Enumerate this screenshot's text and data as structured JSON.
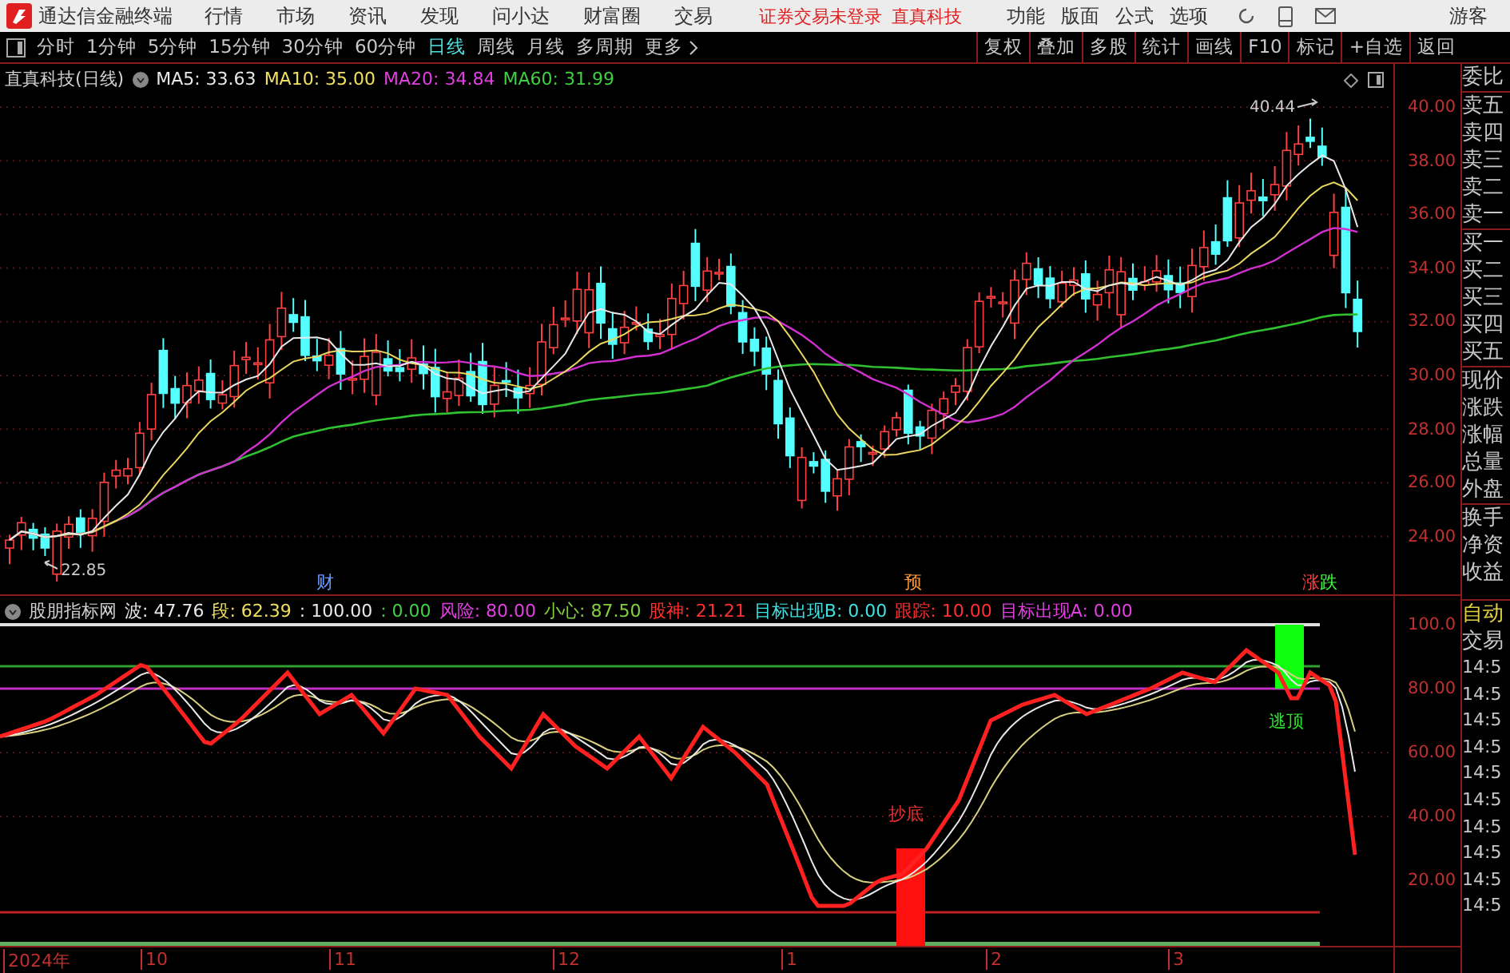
{
  "menu_bar": {
    "app_title": "通达信金融终端",
    "menus": [
      "行情",
      "市场",
      "资讯",
      "发现",
      "问小达",
      "财富圈",
      "交易"
    ],
    "notice": "证券交易未登录",
    "stock_name": "直真科技",
    "right_menus": [
      "功能",
      "版面",
      "公式",
      "选项"
    ],
    "user": "游客"
  },
  "toolbar": {
    "periods": [
      {
        "label": "分时",
        "selected": false
      },
      {
        "label": "1分钟",
        "selected": false
      },
      {
        "label": "5分钟",
        "selected": false
      },
      {
        "label": "15分钟",
        "selected": false
      },
      {
        "label": "30分钟",
        "selected": false
      },
      {
        "label": "60分钟",
        "selected": false
      },
      {
        "label": "日线",
        "selected": true
      },
      {
        "label": "周线",
        "selected": false
      },
      {
        "label": "月线",
        "selected": false
      },
      {
        "label": "多周期",
        "selected": false
      }
    ],
    "more": "更多",
    "actions": [
      "复权",
      "叠加",
      "多股",
      "统计",
      "画线",
      "F10",
      "标记",
      "+自选",
      "返回"
    ]
  },
  "price_chart": {
    "title": "直真科技(日线)",
    "ma_readings": [
      {
        "text": "MA5: 33.63",
        "color": "#e8e8e8"
      },
      {
        "text": "MA10: 35.00",
        "color": "#f0e060"
      },
      {
        "text": "MA20: 34.84",
        "color": "#e040e0"
      },
      {
        "text": "MA60: 31.99",
        "color": "#40d040"
      }
    ],
    "high_label": "40.44",
    "low_label": "22.85",
    "event_markers": [
      {
        "text": "财",
        "color": "#6a9bff"
      },
      {
        "text": "预",
        "color": "#ff9a3c"
      },
      {
        "text": "涨",
        "color": "#ff4040"
      },
      {
        "text": "跌",
        "color": "#40ff40"
      }
    ],
    "yticks": [
      "40.00",
      "38.00",
      "36.00",
      "34.00",
      "32.00",
      "30.00",
      "28.00",
      "26.00",
      "24.00"
    ]
  },
  "indicator": {
    "name": "股朋指标网",
    "readings": [
      {
        "text": "波: 47.76",
        "color": "#e8e8e8"
      },
      {
        "text": "段: 62.39",
        "color": "#f0e060"
      },
      {
        "text": ": 100.00",
        "color": "#e8e8e8"
      },
      {
        "text": ": 0.00",
        "color": "#40d040"
      },
      {
        "text": "风险: 80.00",
        "color": "#e040e0"
      },
      {
        "text": "小心: 87.50",
        "color": "#80d040"
      },
      {
        "text": "股神: 21.21",
        "color": "#ff3030"
      },
      {
        "text": "目标出现B: 0.00",
        "color": "#40e0e0"
      },
      {
        "text": "跟踪: 10.00",
        "color": "#ff3030"
      },
      {
        "text": "目标出现A: 0.00",
        "color": "#e040e0"
      }
    ],
    "signals": [
      {
        "text": "抄底",
        "kind": "buy"
      },
      {
        "text": "逃顶",
        "kind": "sell"
      }
    ],
    "yticks": [
      "100.0",
      "80.00",
      "60.00",
      "40.00",
      "20.00"
    ]
  },
  "date_axis": [
    "2024年",
    "10",
    "11",
    "12",
    "1",
    "2",
    "3"
  ],
  "side_panel": {
    "quote_labels": [
      "委比",
      "卖五",
      "卖四",
      "卖三",
      "卖二",
      "卖一",
      "买一",
      "买二",
      "买三",
      "买四",
      "买五",
      "现价",
      "涨跌",
      "涨幅",
      "总量",
      "外盘",
      "换手",
      "净资",
      "收益"
    ],
    "mode_labels": [
      "自动",
      "交易"
    ],
    "times": [
      "14:5",
      "14:5",
      "14:5",
      "14:5",
      "14:5",
      "14:5",
      "14:5",
      "14:5",
      "14:5",
      "14:5"
    ]
  }
}
